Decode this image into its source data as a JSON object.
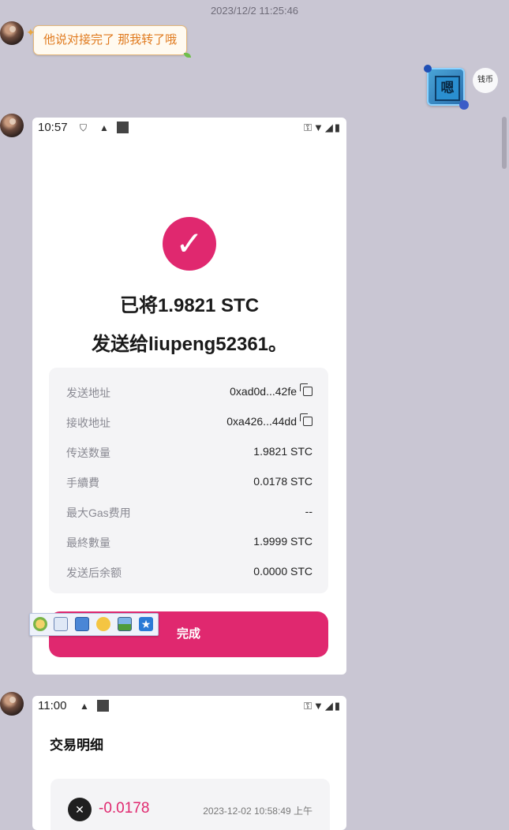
{
  "chat": {
    "timestamp": "2023/12/2 11:25:46",
    "incoming_message": "他说对接完了 那我转了哦",
    "sticker_text": "嗯",
    "self_avatar_text": "钱币"
  },
  "screenshot1": {
    "time": "10:57",
    "check_icon": "✓",
    "headline_line1": "已将1.9821 STC",
    "headline_line2": "发送给liupeng52361。",
    "details": [
      {
        "label": "发送地址",
        "value": "0xad0d...42fe",
        "copy": true
      },
      {
        "label": "接收地址",
        "value": "0xa426...44dd",
        "copy": true
      },
      {
        "label": "传送数量",
        "value": "1.9821 STC",
        "copy": false
      },
      {
        "label": "手續費",
        "value": "0.0178 STC",
        "copy": false
      },
      {
        "label": "最大Gas费用",
        "value": "--",
        "copy": false
      },
      {
        "label": "最終數量",
        "value": "1.9999 STC",
        "copy": false
      },
      {
        "label": "发送后余额",
        "value": "0.0000 STC",
        "copy": false
      }
    ],
    "done_button": "完成"
  },
  "screenshot2": {
    "time": "11:00",
    "title": "交易明细",
    "amount": "-0.0178",
    "datetime": "2023-12-02 10:58:49 上午"
  },
  "icons": {
    "toolbar": [
      "emoji-icon",
      "save-icon",
      "screen-icon",
      "smile-icon",
      "image-icon",
      "star-icon"
    ]
  },
  "colors": {
    "accent": "#e0286f",
    "chat_background": "#c9c6d3",
    "incoming_text": "#e07a1e"
  }
}
